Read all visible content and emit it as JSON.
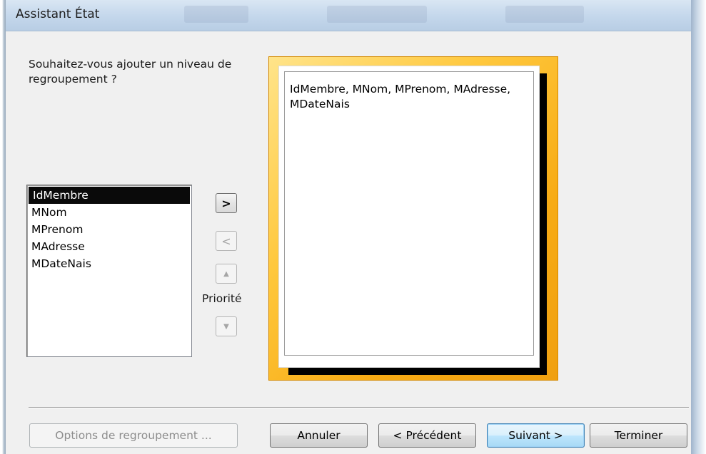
{
  "window": {
    "title": "Assistant État"
  },
  "question": "Souhaitez-vous ajouter un niveau de regroupement ?",
  "fields": {
    "items": [
      "IdMembre",
      "MNom",
      "MPrenom",
      "MAdresse",
      "MDateNais"
    ],
    "selected": "IdMembre"
  },
  "shuttle": {
    "add_label": ">",
    "remove_label": "<",
    "up_glyph": "▲",
    "down_glyph": "▼",
    "priority_label": "Priorité"
  },
  "preview": {
    "group_text": "IdMembre, MNom, MPrenom, MAdresse, MDateNais"
  },
  "buttons": {
    "options": "Options de regroupement ...",
    "cancel": "Annuler",
    "previous": "< Précédent",
    "next": "Suivant >",
    "finish": "Terminer"
  },
  "colors": {
    "preview_frame": "#f7ab14",
    "selection": "#0a0a0a",
    "default_button": "#bee6fd"
  }
}
